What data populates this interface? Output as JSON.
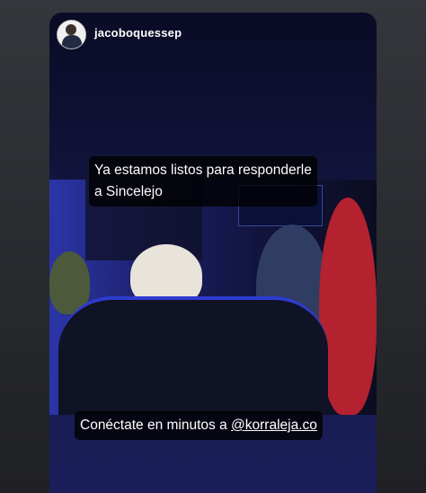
{
  "story": {
    "username": "jacoboquessep",
    "caption_top": "Ya estamos listos para responderle a Sincelejo",
    "caption_bottom_prefix": "Conéctate en minutos a ",
    "caption_bottom_handle": "@korraleja.co",
    "photo_subject": "radio-studio-photo"
  }
}
